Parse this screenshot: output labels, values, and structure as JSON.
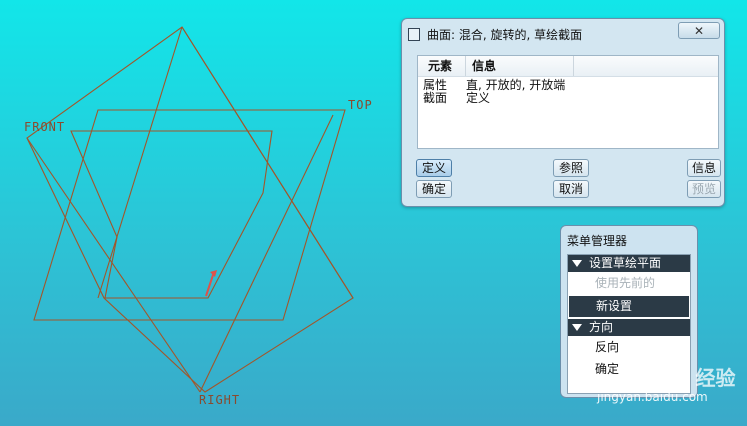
{
  "viewport": {
    "labels": {
      "front": "FRONT",
      "top": "TOP",
      "right": "RIGHT"
    },
    "colors": {
      "plane": "#a2562a",
      "arrow": "#e0524a"
    }
  },
  "dialog": {
    "title": "曲面: 混合, 旋转的, 草绘截面",
    "close_label": "",
    "columns": {
      "element": "元素",
      "info": "信息"
    },
    "rows": [
      {
        "element": "属性",
        "info": "直, 开放的, 开放端"
      },
      {
        "element": "截面",
        "info": "定义"
      }
    ],
    "buttons": {
      "define": "定义",
      "confirm": "确定",
      "reference": "参照",
      "cancel": "取消",
      "info": "信息",
      "preview": "预览"
    }
  },
  "menu_manager": {
    "title": "菜单管理器",
    "sections": [
      {
        "header": "设置草绘平面",
        "items": [
          {
            "label": "使用先前的",
            "state": "disabled"
          },
          {
            "label": "新设置",
            "state": "selected"
          }
        ]
      },
      {
        "header": "方向",
        "items": [
          {
            "label": "反向",
            "state": "normal"
          },
          {
            "label": "确定",
            "state": "normal"
          }
        ]
      }
    ]
  },
  "watermark": {
    "brand": "Bai 经验",
    "url": "jingyan.baidu.com"
  }
}
